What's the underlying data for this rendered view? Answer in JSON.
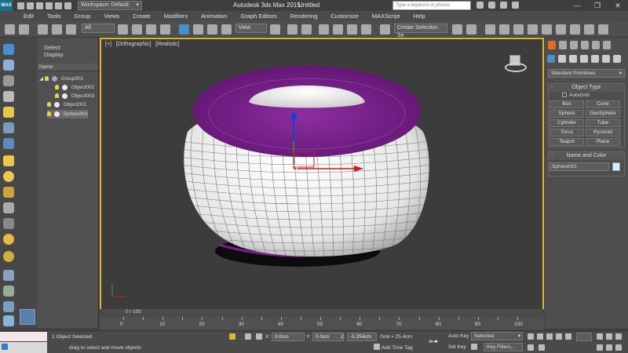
{
  "titlebar": {
    "app_logo": "MAX",
    "workspace": "Workspace: Default",
    "app_title": "Autodesk 3ds Max  2015",
    "file_title": "Untitled",
    "search_placeholder": "Type a keyword or phrase",
    "win_min": "—",
    "win_max": "❐",
    "win_close": "✕"
  },
  "menu": [
    "Edit",
    "Tools",
    "Group",
    "Views",
    "Create",
    "Modifiers",
    "Animation",
    "Graph Editors",
    "Rendering",
    "Customize",
    "MAXScript",
    "Help"
  ],
  "toolbar": {
    "filter_select": "All",
    "ref_coord": "View",
    "named_selection": "Create Selection Se"
  },
  "explorer": {
    "tabs": [
      "Select",
      "Display"
    ],
    "column_header": "Name",
    "items": [
      {
        "label": "Group001"
      },
      {
        "label": "Object002"
      },
      {
        "label": "Object003"
      },
      {
        "label": "Object001"
      },
      {
        "label": "Sphere001"
      }
    ]
  },
  "viewport": {
    "label_plus": "[+]",
    "label_view": "[Orthographic]",
    "label_shading": "[Realistic]"
  },
  "timeline": {
    "frame_label": "0 / 100",
    "ticks": [
      0,
      10,
      20,
      30,
      40,
      50,
      60,
      70,
      80,
      90,
      100
    ]
  },
  "command_panel": {
    "category": "Standard Primitives",
    "object_type_title": "Object Type",
    "autogrid": "AutoGrid",
    "primitives": [
      "Box",
      "Cone",
      "Sphere",
      "GeoSphere",
      "Cylinder",
      "Tube",
      "Torus",
      "Pyramid",
      "Teapot",
      "Plane"
    ],
    "name_color_title": "Name and Color",
    "object_name": "Sphere001",
    "object_color": "#d6efff"
  },
  "status": {
    "selection": "1 Object Selected",
    "prompt": "drag to select and move objects",
    "x_label": "X:",
    "x_value": "0.0cm",
    "y_label": "Y:",
    "y_value": "0.0cm",
    "z_label": "Z:",
    "z_value": "-5.254cm",
    "grid": "Grid = 25.4cm",
    "add_time_tag": "Add Time Tag",
    "auto_key": "Auto Key",
    "selected": "Selected",
    "set_key": "Set Key",
    "key_filters": "Key Filters..."
  },
  "colors": {
    "accent_viewport_border": "#e0b42b",
    "object_purple": "#7a1f8c",
    "gizmo_z": "#1a3dd6",
    "gizmo_x": "#d61a1a",
    "gizmo_y": "#1aa82f"
  }
}
